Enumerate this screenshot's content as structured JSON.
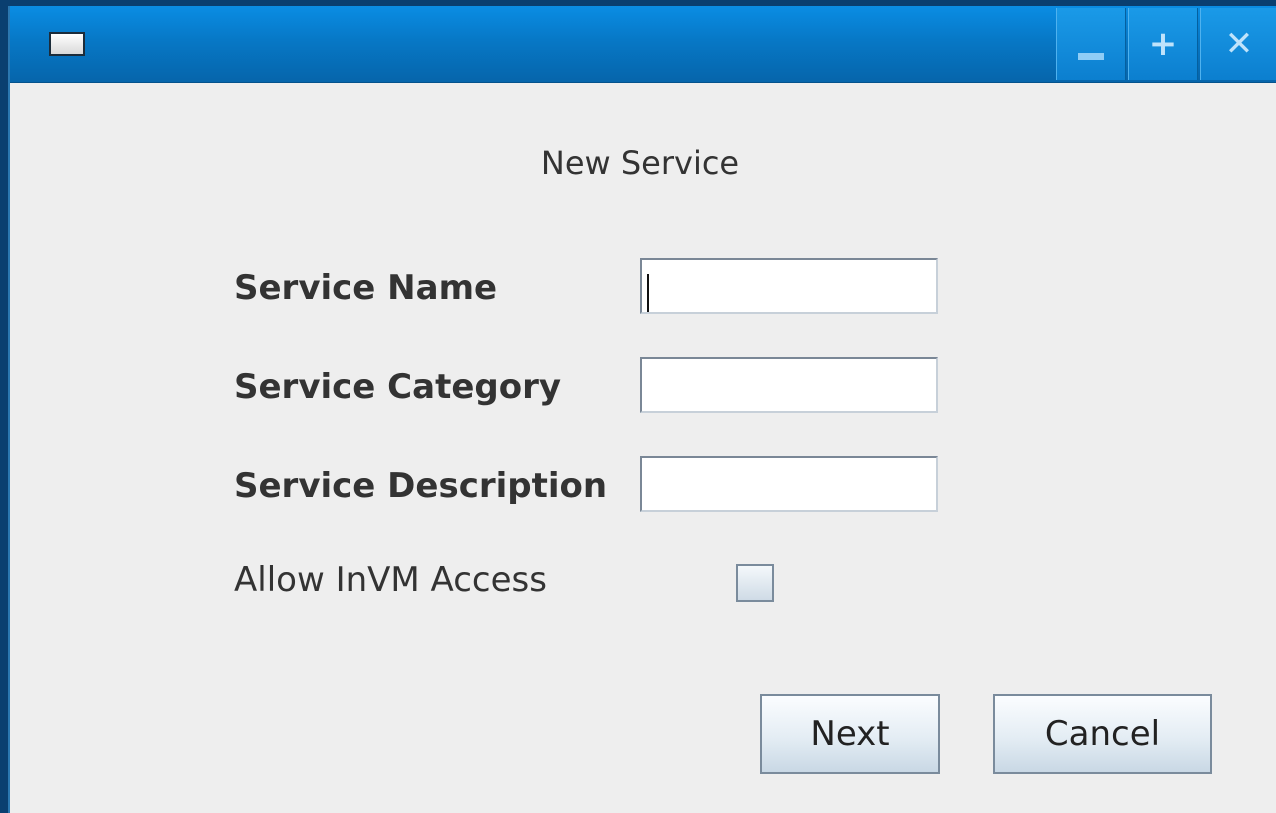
{
  "window": {
    "title": "",
    "controls": {
      "minimize_icon": "minimize-icon",
      "maximize_icon": "maximize-icon",
      "close_icon": "close-icon",
      "maximize_glyph": "+",
      "close_glyph": "✕"
    }
  },
  "dialog": {
    "heading": "New Service",
    "fields": [
      {
        "label": "Service Name",
        "value": "",
        "placeholder": ""
      },
      {
        "label": "Service Category",
        "value": "",
        "placeholder": ""
      },
      {
        "label": "Service Description",
        "value": "",
        "placeholder": ""
      }
    ],
    "checkbox": {
      "label": "Allow InVM Access",
      "checked": false
    },
    "buttons": {
      "next_label": "Next",
      "cancel_label": "Cancel"
    }
  },
  "colors": {
    "titlebar": "#0778c6",
    "background": "#eeeeee",
    "text": "#333333"
  }
}
